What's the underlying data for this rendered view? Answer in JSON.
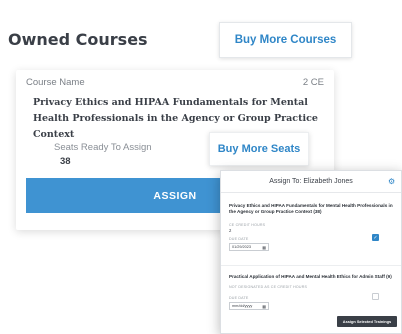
{
  "header": {
    "title": "Owned Courses",
    "buy_more_courses": "Buy More Courses"
  },
  "course": {
    "name_label": "Course Name",
    "ce": "2 CE",
    "title": "Privacy Ethics and HIPAA Fundamentals for Mental Health Professionals in the Agency or Group Practice Context",
    "seats_label": "Seats Ready To Assign",
    "seats_value": "38",
    "buy_more_seats": "Buy More Seats",
    "assign_label": "ASSIGN"
  },
  "modal": {
    "title": "Assign To: Elizabeth Jones",
    "items": [
      {
        "title": "Privacy Ethics and HIPAA Fundamentals for Mental Health Professionals in the Agency or Group Practice Context (38)",
        "ce_label": "CE CREDIT HOURS",
        "ce_value": "2",
        "due_label": "DUE DATE",
        "due_value": "01/29/2023",
        "checked": true
      },
      {
        "title": "Practical Application of HIPAA and Mental Health Ethics for Admin Staff (9)",
        "ce_label": "NOT DESIGNATED AS CE CREDIT HOURS",
        "due_label": "DUE DATE",
        "due_value": "mm/dd/yyyy",
        "checked": false
      }
    ],
    "assign_selected": "Assign Selected Trainings"
  },
  "colors": {
    "accent": "#3f93d2",
    "link": "#2f86c7",
    "dark": "#3a3f47"
  }
}
